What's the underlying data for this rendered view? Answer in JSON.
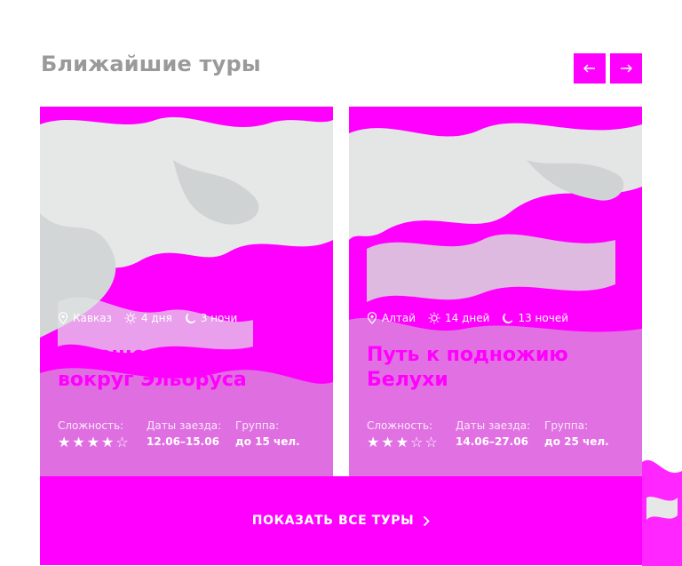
{
  "section": {
    "title": "Ближайшие туры"
  },
  "slider": {
    "prev_icon": "arrow-left-icon",
    "next_icon": "arrow-right-icon"
  },
  "tours": [
    {
      "region": "Кавказ",
      "days": "4 дня",
      "nights": "3 ночи",
      "title_line1": "Путешествие",
      "title_line2": "вокруг Эльбруса",
      "difficulty_label": "Сложность:",
      "difficulty_stars": 4,
      "difficulty_max": 5,
      "dates_label": "Даты заезда:",
      "dates": "12.06–15.06",
      "group_label": "Группа:",
      "group": "до 15 чел."
    },
    {
      "region": "Алтай",
      "days": "14 дней",
      "nights": "13 ночей",
      "title_line1": "Путь к подножию",
      "title_line2": "Белухи",
      "difficulty_label": "Сложность:",
      "difficulty_stars": 3,
      "difficulty_max": 5,
      "dates_label": "Даты заезда:",
      "dates": "14.06–27.06",
      "group_label": "Группа:",
      "group": "до 25 чел."
    }
  ],
  "show_all": {
    "label": "ПОКАЗАТЬ ВСЕ ТУРЫ",
    "icon": "chevron-right-icon"
  },
  "colors": {
    "accent": "#ff00ff",
    "title_gray": "#9a9a9a",
    "snow": "#e4e6e6",
    "rock": "#b9bdbd"
  }
}
